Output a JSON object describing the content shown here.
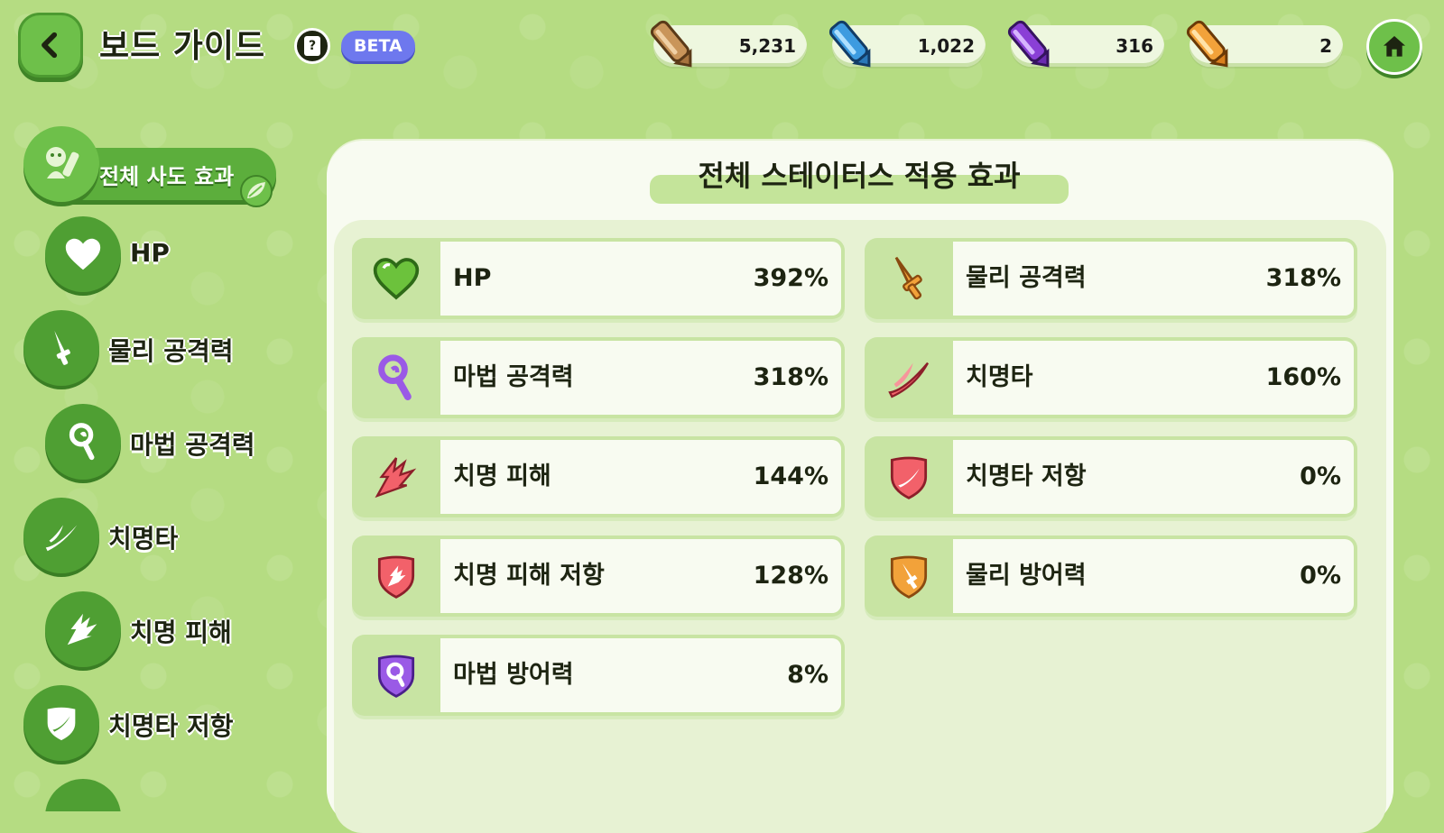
{
  "header": {
    "title": "보드 가이드",
    "help_label": "?",
    "badge": "BETA"
  },
  "currencies": [
    {
      "icon": "brown-crystal-icon",
      "value": "5,231",
      "color": "#c9955a"
    },
    {
      "icon": "blue-crystal-icon",
      "value": "1,022",
      "color": "#3d9be0"
    },
    {
      "icon": "purple-crystal-icon",
      "value": "316",
      "color": "#8a3fd6"
    },
    {
      "icon": "orange-crystal-icon",
      "value": "2",
      "color": "#f2a23a"
    }
  ],
  "sidebar": {
    "active": {
      "label": "전체 사도 효과"
    },
    "items": [
      {
        "label": "HP",
        "icon": "heart-icon"
      },
      {
        "label": "물리 공격력",
        "icon": "sword-icon"
      },
      {
        "label": "마법 공격력",
        "icon": "magic-wand-icon"
      },
      {
        "label": "치명타",
        "icon": "crit-slash-icon"
      },
      {
        "label": "치명 피해",
        "icon": "crit-burst-icon"
      },
      {
        "label": "치명타 저항",
        "icon": "crit-shield-icon"
      }
    ]
  },
  "panel": {
    "title": "전체 스테이터스 적용 효과",
    "stats": [
      {
        "name": "HP",
        "value": "392%",
        "icon": "heart-icon"
      },
      {
        "name": "물리 공격력",
        "value": "318%",
        "icon": "sword-icon"
      },
      {
        "name": "마법 공격력",
        "value": "318%",
        "icon": "magic-wand-icon"
      },
      {
        "name": "치명타",
        "value": "160%",
        "icon": "crit-slash-icon"
      },
      {
        "name": "치명 피해",
        "value": "144%",
        "icon": "crit-burst-icon"
      },
      {
        "name": "치명타 저항",
        "value": "0%",
        "icon": "crit-shield-icon"
      },
      {
        "name": "치명 피해 저항",
        "value": "128%",
        "icon": "crit-damage-shield-icon"
      },
      {
        "name": "물리 방어력",
        "value": "0%",
        "icon": "physical-defense-icon"
      },
      {
        "name": "마법 방어력",
        "value": "8%",
        "icon": "magic-defense-icon"
      }
    ]
  },
  "colors": {
    "background": "#b5dc82",
    "accent_green": "#5cae3c",
    "beta_badge": "#6e78ee",
    "panel": "#f8fbf1"
  }
}
